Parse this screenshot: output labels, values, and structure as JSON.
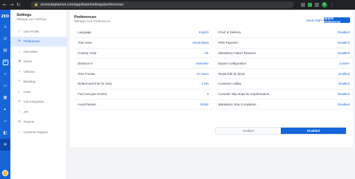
{
  "browser": {
    "nav_icons": [
      "back-icon",
      "forward-icon",
      "reload-icon"
    ],
    "url": "zeoroutеplanner.com/app/team/settings/preferences",
    "profile_initial": "K"
  },
  "rail": {
    "logo": "ZEO"
  },
  "settings_panel": {
    "title": "Settings",
    "subtitle": "Manage your settings",
    "items": [
      {
        "label": "User Profile",
        "icon": "user-icon"
      },
      {
        "label": "Preferences",
        "icon": "sliders-icon"
      },
      {
        "label": "Favourites",
        "icon": "star-icon"
      },
      {
        "label": "Stores",
        "icon": "store-icon"
      },
      {
        "label": "Vehicles",
        "icon": "truck-icon"
      },
      {
        "label": "Branding",
        "icon": "brush-icon"
      },
      {
        "label": "Hubs",
        "icon": "hub-icon"
      },
      {
        "label": "Can Integration",
        "icon": "plug-icon"
      },
      {
        "label": "API",
        "icon": "code-icon"
      },
      {
        "label": "Reports",
        "icon": "report-icon"
      },
      {
        "label": "Customer Support",
        "icon": "support-icon"
      }
    ]
  },
  "main": {
    "title": "Preferences",
    "subtitle": "Manage Your Preferences",
    "help": "Need Help?",
    "update_button": "Update Preferences",
    "left_rows": [
      {
        "label": "Language",
        "value": "English"
      },
      {
        "label": "Time Zone",
        "value": "Asia/Kolkata"
      },
      {
        "label": "Country Code",
        "value": "+91"
      },
      {
        "label": "Distance In",
        "value": "Kilometer"
      },
      {
        "label": "Time Format",
        "value": "12 Hours"
      },
      {
        "label": "Default wait time for Stop",
        "value": "2 Min"
      },
      {
        "label": "Fuel cost (per Km/mi)",
        "value": "0"
      },
      {
        "label": "Avoid Passes",
        "value": "NONE"
      }
    ],
    "right_rows": [
      {
        "label": "Proof of Delivery",
        "value": "Disabled"
      },
      {
        "label": "POD Payment",
        "value": "Disabled"
      },
      {
        "label": "Mandatory Failure Reasons",
        "value": "Disabled"
      },
      {
        "label": "Export Configuration",
        "value": "Custom"
      },
      {
        "label": "Route Edit by driver",
        "value": "Enabled"
      },
      {
        "label": "Customer calling",
        "value": "Enabled"
      },
      {
        "label": "Consider skip stops for reoptimization",
        "value": "Disabled"
      },
      {
        "label": "Mandatory Stop Completion",
        "value": "Disabled"
      }
    ],
    "toggle": {
      "options": [
        "Enabled",
        "Disabled"
      ],
      "selected": "Disabled"
    }
  },
  "colors": {
    "accent": "#1565d8",
    "rail": "#1565d8",
    "active_item_bg": "#dfeafd"
  }
}
